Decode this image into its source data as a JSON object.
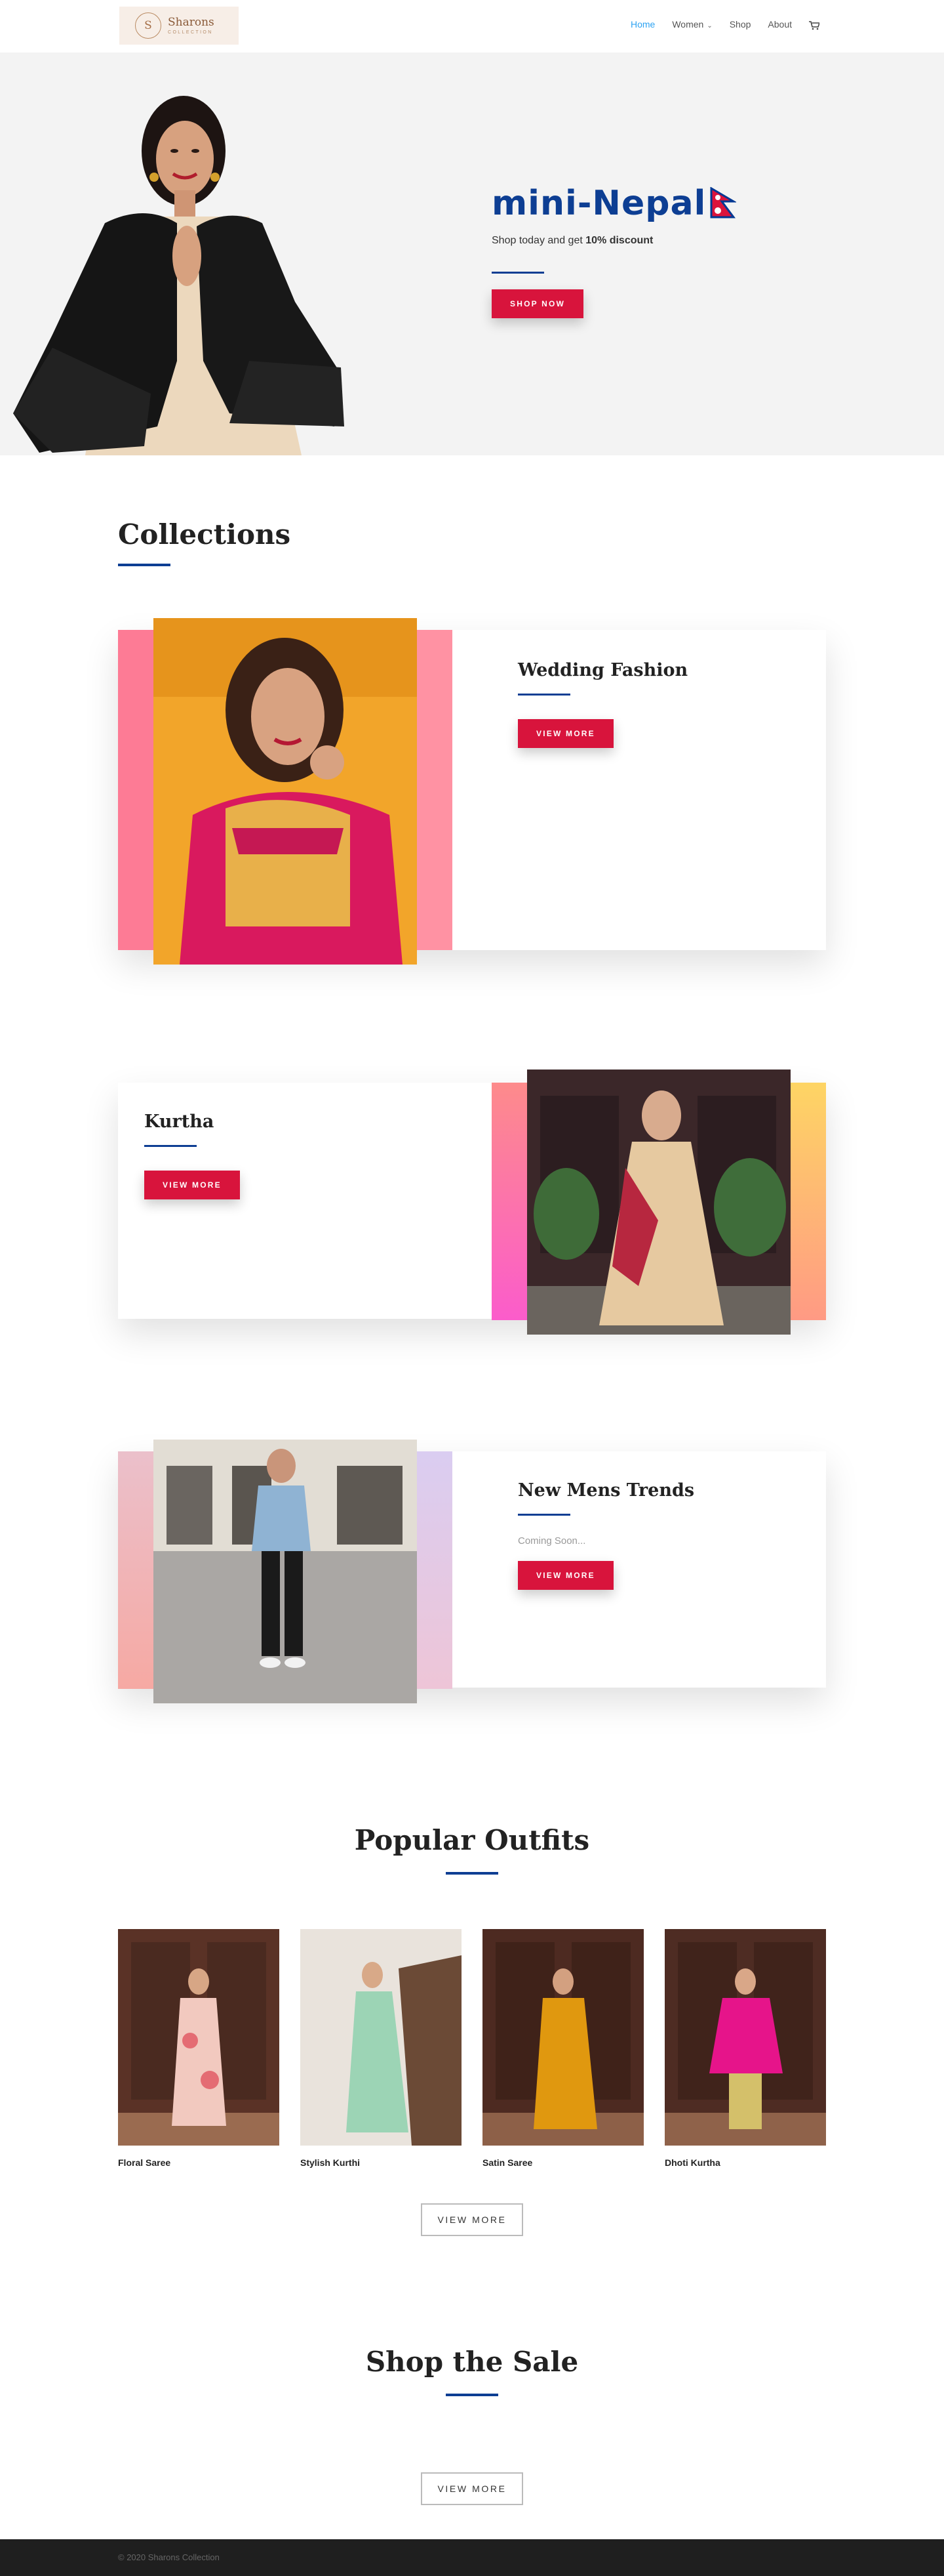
{
  "header": {
    "logo_letter": "S",
    "logo_name": "Sharons",
    "logo_sub": "Collection",
    "nav": [
      {
        "label": "Home",
        "active": true
      },
      {
        "label": "Women",
        "dropdown": true
      },
      {
        "label": "Shop"
      },
      {
        "label": "About"
      }
    ]
  },
  "hero": {
    "title": "mini-Nepal",
    "subtitle_prefix": "Shop today and get ",
    "subtitle_bold": "10% discount",
    "button": "Shop Now"
  },
  "collections": {
    "title": "Collections",
    "items": [
      {
        "title": "Wedding Fashion",
        "text": "",
        "button": "View More"
      },
      {
        "title": "Kurtha",
        "text": "",
        "button": "View More"
      },
      {
        "title": "New Mens Trends",
        "text": "Coming Soon...",
        "button": "View More"
      }
    ]
  },
  "popular": {
    "title": "Popular Outfits",
    "items": [
      {
        "label": "Floral Saree"
      },
      {
        "label": "Stylish Kurthi"
      },
      {
        "label": "Satin Saree"
      },
      {
        "label": "Dhoti Kurtha"
      }
    ],
    "button": "View More"
  },
  "sale": {
    "title": "Shop the Sale",
    "button": "View More"
  },
  "footer": {
    "copyright": "© 2020 Sharons Collection"
  },
  "colors": {
    "accent_blue": "#0d3e93",
    "button_red": "#d8143c",
    "nav_active": "#2ea3f2"
  }
}
